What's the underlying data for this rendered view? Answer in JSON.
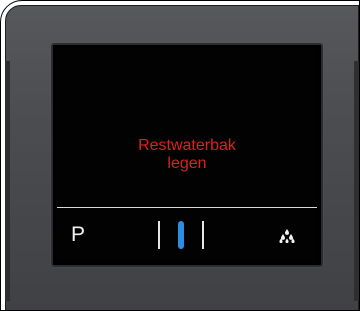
{
  "display": {
    "message_line1": "Restwaterbak",
    "message_line2": "legen",
    "message_color": "#e0211b",
    "program_label": "P",
    "level": {
      "steps": 3,
      "active_index": 2,
      "active_color": "#2a8fe3"
    },
    "drops_icon": "drops-icon"
  }
}
